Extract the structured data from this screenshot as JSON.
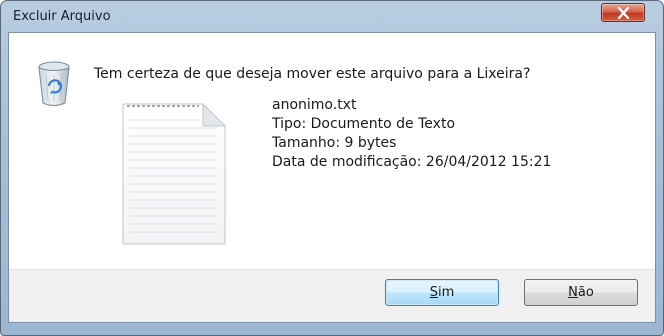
{
  "window": {
    "title": "Excluir Arquivo"
  },
  "dialog": {
    "question": "Tem certeza de que deseja mover este arquivo para a Lixeira?",
    "file": {
      "name": "anonimo.txt",
      "type": "Tipo: Documento de Texto",
      "size": "Tamanho: 9 bytes",
      "modified": "Data de modificação: 26/04/2012 15:21"
    }
  },
  "buttons": {
    "yes": {
      "mnemonic": "S",
      "rest": "im"
    },
    "no": {
      "mnemonic": "N",
      "rest": "ão"
    }
  },
  "icons": {
    "window_close": "close-icon",
    "recycle_bin": "recycle-bin-icon",
    "file": "text-document-icon"
  },
  "colors": {
    "titlebar": "#a7bfd9",
    "close_button": "#c03a22",
    "default_button_border": "#3c7fb1",
    "footer": "#f0f0f0"
  }
}
